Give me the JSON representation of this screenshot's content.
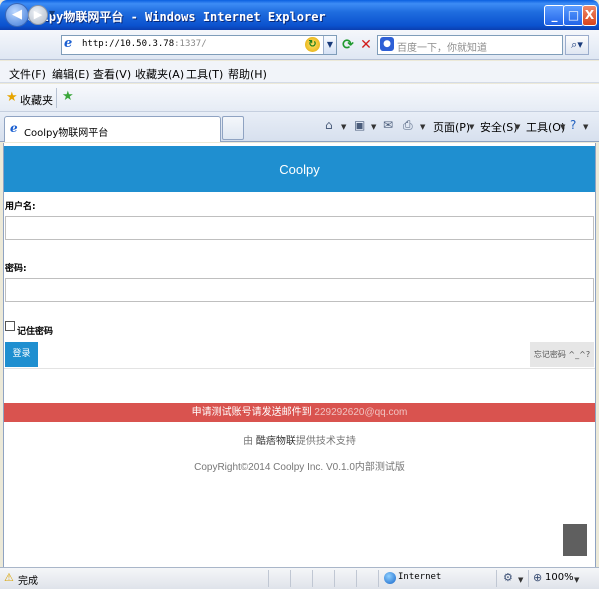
{
  "window": {
    "title": "Coolpy物联网平台 - Windows Internet Explorer",
    "buttons": [
      "_",
      "□",
      "X"
    ]
  },
  "address": {
    "url_main": "http://10.50.3.78",
    "url_port": ":1337/",
    "search_placeholder": "百度一下，你就知道"
  },
  "menu": [
    "文件(F)",
    "编辑(E)",
    "查看(V)",
    "收藏夹(A)",
    "工具(T)",
    "帮助(H)"
  ],
  "favorites": {
    "label": "收藏夹"
  },
  "tab": {
    "label": "Coolpy物联网平台"
  },
  "commandbar": {
    "page": "页面(P)",
    "safety": "安全(S)",
    "tools": "工具(O)"
  },
  "page": {
    "header_title": "Coolpy",
    "username_label": "用户名:",
    "username_value": "",
    "password_label": "密码:",
    "password_value": "",
    "remember_label": "记住密码",
    "remember_checked": false,
    "login_button": "登录",
    "forgot_link": "忘记密码 ^_^?",
    "banner_text": "申请测试账号请发送邮件到 ",
    "banner_email": "229292620@qq.com",
    "support_prefix": "由 ",
    "support_brand": "酷痞物联",
    "support_suffix": "提供技术支持",
    "copyright": "CopyRight©2014 Coolpy Inc. V0.1.0内部测试版"
  },
  "statusbar": {
    "status": "完成",
    "zone": "Internet",
    "zoom": "100%"
  },
  "colors": {
    "header": "#1f8fd0",
    "banner": "#d9534f",
    "login": "#1f8fd0"
  }
}
